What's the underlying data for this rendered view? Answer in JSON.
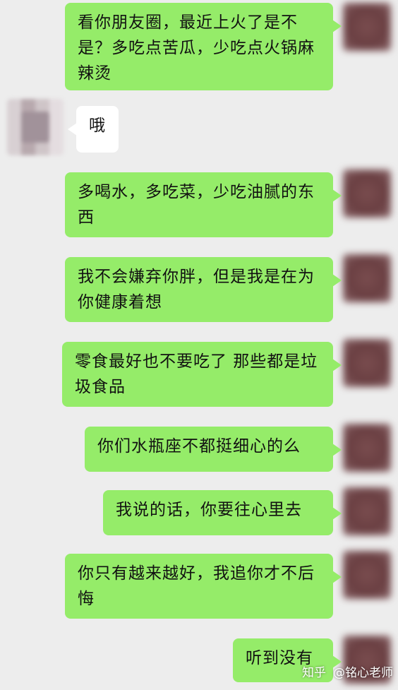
{
  "conversation": {
    "messages": [
      {
        "sender": "me",
        "text": "看你朋友圈，最近上火了是不是？多吃点苦瓜，少吃点火锅麻辣烫"
      },
      {
        "sender": "other",
        "text": "哦"
      },
      {
        "sender": "me",
        "text": "多喝水，多吃菜，少吃油腻的东西"
      },
      {
        "sender": "me",
        "text": "我不会嫌弃你胖，但是我是在为你健康着想"
      },
      {
        "sender": "me",
        "text": "零食最好也不要吃了 那些都是垃圾食品"
      },
      {
        "sender": "me",
        "text": "你们水瓶座不都挺细心的么"
      },
      {
        "sender": "me",
        "text": "我说的话，你要往心里去"
      },
      {
        "sender": "me",
        "text": "你只有越来越好，我追你才不后悔"
      },
      {
        "sender": "me",
        "text": "听到没有"
      }
    ]
  },
  "watermark": {
    "site": "知乎",
    "author": "@铭心老师"
  },
  "colors": {
    "background": "#ededed",
    "my_bubble": "#95ec69",
    "other_bubble": "#ffffff"
  },
  "icons": {
    "my_avatar": "avatar-blurred",
    "other_avatar": "avatar-blurred"
  }
}
